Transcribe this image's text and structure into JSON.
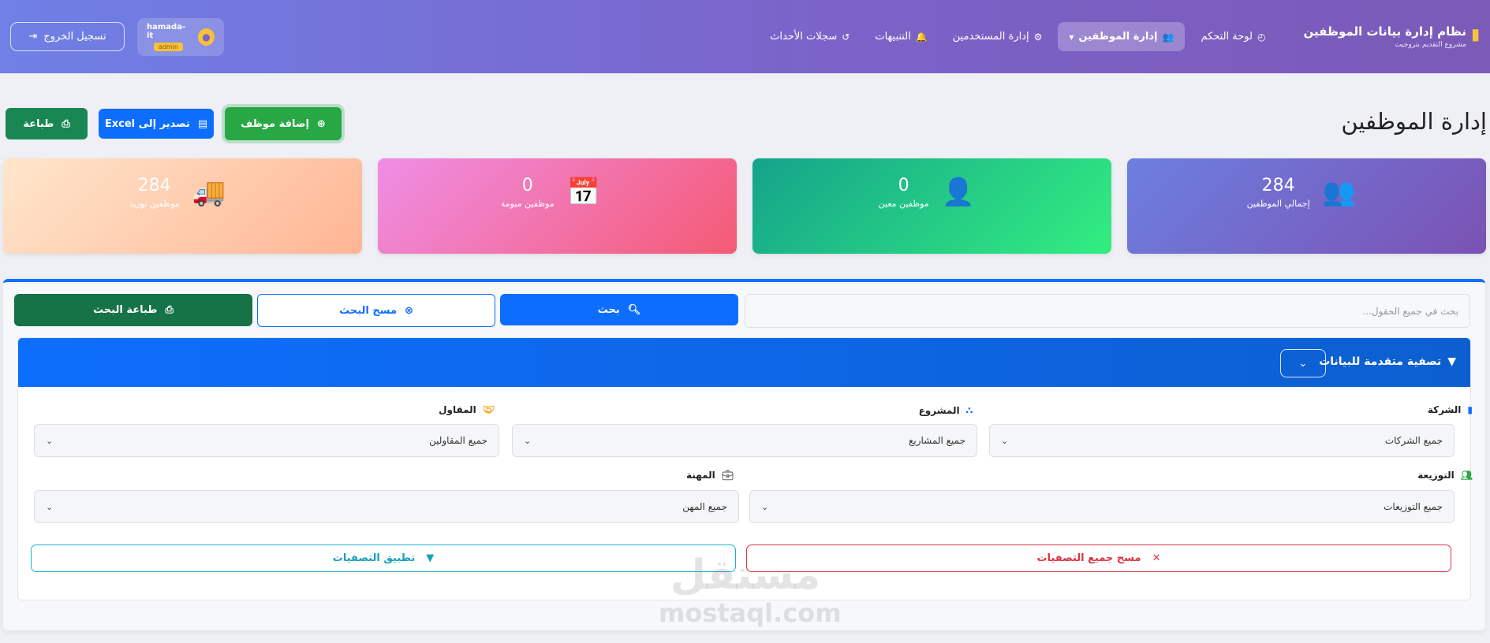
{
  "brand": {
    "title": "نظام إدارة بيانات الموظفين",
    "subtitle": "مشروع التقديم بتروجيت",
    "icon": "building-icon"
  },
  "nav": {
    "items": [
      {
        "label": "لوحة التحكم",
        "icon": "dashboard-icon"
      },
      {
        "label": "إدارة الموظفين",
        "icon": "users-icon",
        "active": true,
        "caret": "▾"
      },
      {
        "label": "إدارة المستخدمين",
        "icon": "user-gear-icon"
      },
      {
        "label": "التنبيهات",
        "icon": "bell-icon"
      },
      {
        "label": "سجلات الأحداث",
        "icon": "history-icon"
      }
    ]
  },
  "user": {
    "name": "hamada-it",
    "role": "admin"
  },
  "logout": {
    "label": "تسجيل الخروج"
  },
  "page": {
    "title": "إدارة الموظفين"
  },
  "actions": {
    "add": "إضافة موظف",
    "export": "تصدير إلى Excel",
    "print": "طباعة"
  },
  "stats": [
    {
      "value": "284",
      "label": "إجمالي الموظفين",
      "icon": "users-icon"
    },
    {
      "value": "0",
      "label": "موظفين معين",
      "icon": "user-tie-icon"
    },
    {
      "value": "0",
      "label": "موظفين مبومة",
      "icon": "calendar-icon"
    },
    {
      "value": "284",
      "label": "موظفين توريد",
      "icon": "truck-icon"
    }
  ],
  "search": {
    "placeholder": "بحث في جميع الحقول...",
    "search_label": "بحث",
    "clear_label": "مسح البحث",
    "print_label": "طباعة البحث"
  },
  "filters": {
    "title": "تصفية متقدمة للبيانات",
    "company": {
      "label": "الشركة",
      "value": "جميع الشركات"
    },
    "project": {
      "label": "المشروع",
      "value": "جميع المشاريع"
    },
    "contractor": {
      "label": "المقاول",
      "value": "جميع المقاولين"
    },
    "distribution": {
      "label": "التوزيعة",
      "value": "جميع التوزيعات"
    },
    "profession": {
      "label": "المهنة",
      "value": "جميع المهن"
    },
    "clear_all": "مسح جميع التصفيات",
    "apply": "تطبيق التصفيات"
  },
  "watermark": {
    "ar": "مستقل",
    "en": "mostaql.com"
  },
  "colors": {
    "primary": "#0d6efd",
    "success": "#28a745",
    "danger": "#dc3545",
    "info": "#17a2b8"
  }
}
